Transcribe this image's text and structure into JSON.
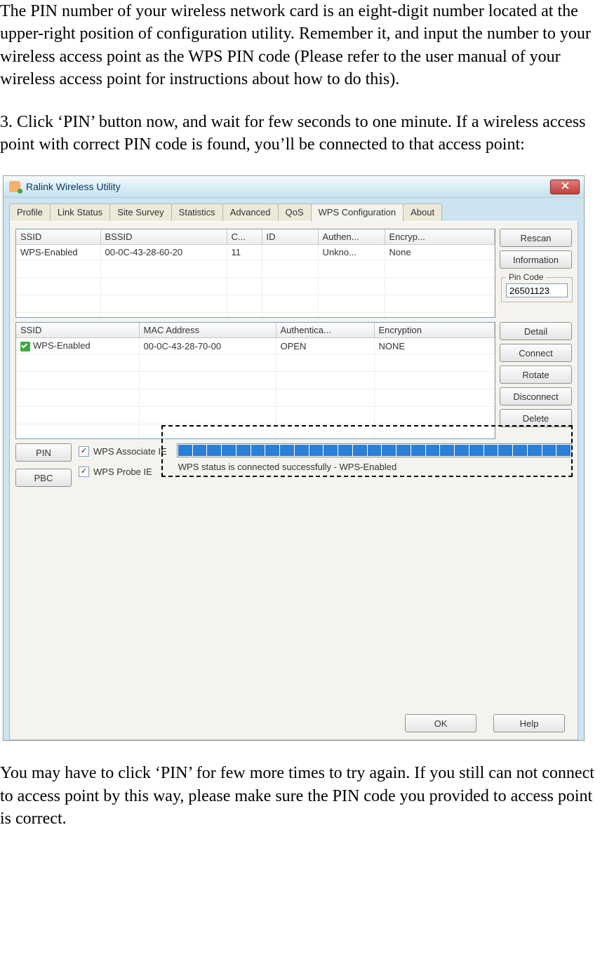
{
  "doc": {
    "p1": "The PIN number of your wireless network card is an eight-digit number located at the upper-right position of configuration utility. Remember it, and input the number to your wireless access point as the WPS PIN code (Please refer to the user manual of your wireless access point for instructions about how to do this).",
    "p2": "3. Click ‘PIN’ button now, and wait for few seconds to one minute. If a wireless access point with correct PIN code is found, you’ll be connected to that access point:",
    "p3": "You may have to click ‘PIN’ for few more times to try again. If you still can not connect to access point by this way, please make sure the PIN code you provided to access point is correct."
  },
  "app": {
    "title": "Ralink Wireless Utility",
    "tabs": [
      "Profile",
      "Link Status",
      "Site Survey",
      "Statistics",
      "Advanced",
      "QoS",
      "WPS Configuration",
      "About"
    ],
    "active_tab": "WPS Configuration",
    "top_table": {
      "headers": [
        "SSID",
        "BSSID",
        "C...",
        "ID",
        "Authen...",
        "Encryp..."
      ],
      "rows": [
        {
          "ssid": "WPS-Enabled",
          "bssid": "00-0C-43-28-60-20",
          "ch": "11",
          "id": "",
          "auth": "Unkno...",
          "enc": "None"
        }
      ]
    },
    "side_top": {
      "rescan": "Rescan",
      "information": "Information",
      "pin_label": "Pin Code",
      "pin_value": "26501123"
    },
    "bottom_table": {
      "headers": [
        "SSID",
        "MAC Address",
        "Authentica...",
        "Encryption"
      ],
      "rows": [
        {
          "ssid": "WPS-Enabled",
          "mac": "00-0C-43-28-70-00",
          "auth": "OPEN",
          "enc": "NONE"
        }
      ]
    },
    "side_bottom": {
      "detail": "Detail",
      "connect": "Connect",
      "rotate": "Rotate",
      "disconnect": "Disconnect",
      "delete": "Delete"
    },
    "controls": {
      "pin": "PIN",
      "pbc": "PBC",
      "assoc": "WPS Associate IE",
      "probe": "WPS Probe IE",
      "status": "WPS status is connected successfully - WPS-Enabled"
    },
    "footer": {
      "ok": "OK",
      "help": "Help"
    }
  }
}
